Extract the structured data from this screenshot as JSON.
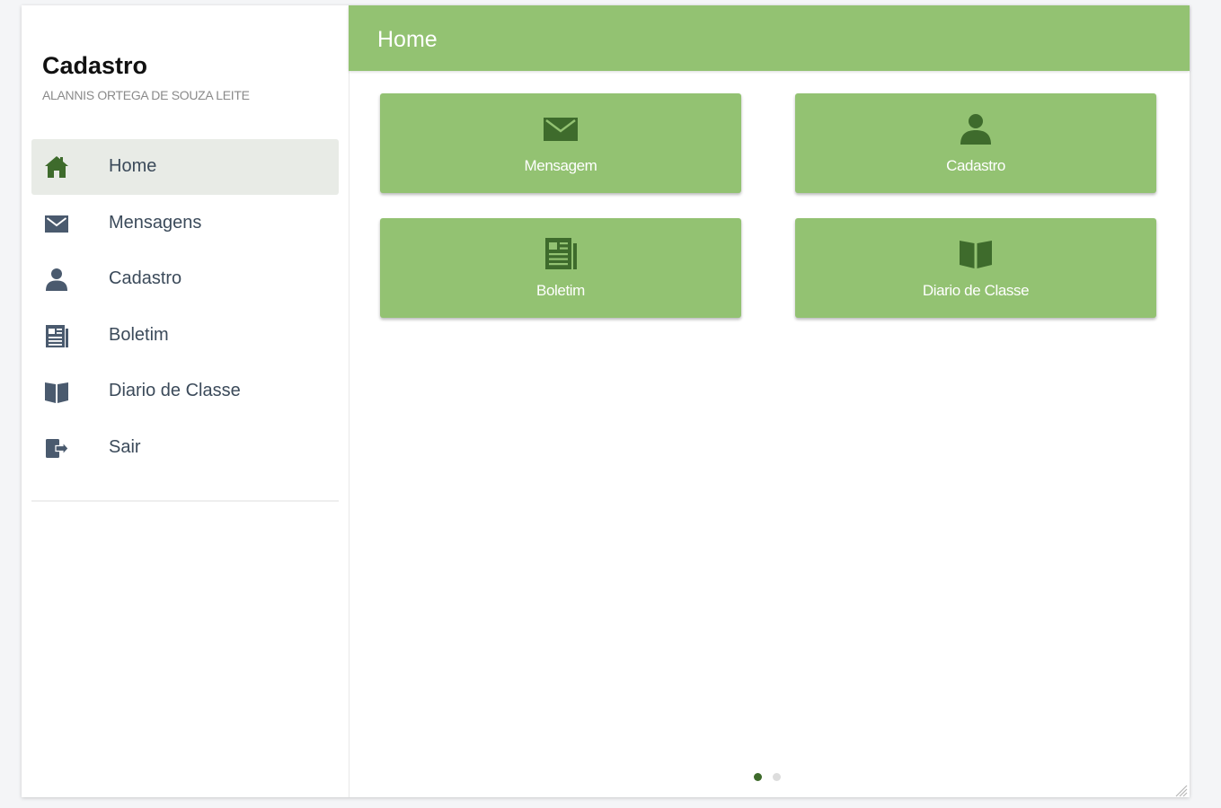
{
  "sidebar": {
    "title": "Cadastro",
    "subtitle": "ALANNIS ORTEGA DE SOUZA LEITE",
    "items": [
      {
        "label": "Home",
        "icon": "home-icon",
        "active": true
      },
      {
        "label": "Mensagens",
        "icon": "envelope-icon",
        "active": false
      },
      {
        "label": "Cadastro",
        "icon": "user-icon",
        "active": false
      },
      {
        "label": "Boletim",
        "icon": "newspaper-icon",
        "active": false
      },
      {
        "label": "Diario de Classe",
        "icon": "book-icon",
        "active": false
      },
      {
        "label": "Sair",
        "icon": "sign-out-icon",
        "active": false
      }
    ]
  },
  "header": {
    "title": "Home"
  },
  "tiles": [
    {
      "label": "Mensagem",
      "icon": "envelope-icon"
    },
    {
      "label": "Cadastro",
      "icon": "user-icon"
    },
    {
      "label": "Boletim",
      "icon": "newspaper-icon"
    },
    {
      "label": "Diario de Classe",
      "icon": "book-icon"
    }
  ],
  "pager": {
    "page_count": 2,
    "current_page": 1
  },
  "colors": {
    "accent_green": "#93c272",
    "tile_icon_green": "#3e6b2c",
    "menu_icon_slate": "#4a5a6e",
    "active_item_bg": "#e8ebe6",
    "dot_active": "#3e6b2c",
    "dot_inactive": "#dddddd"
  }
}
